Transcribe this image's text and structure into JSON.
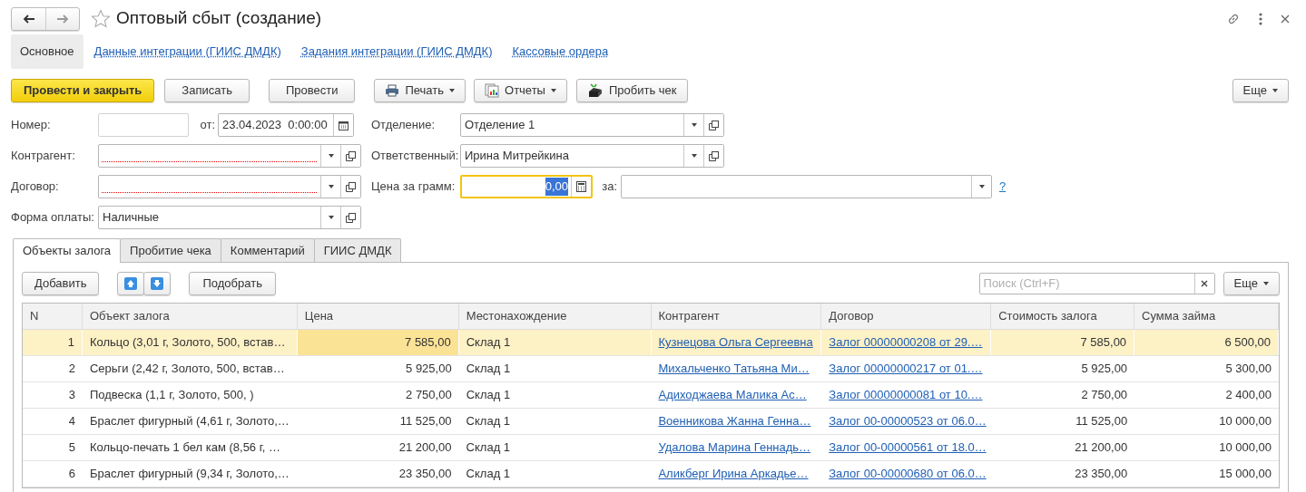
{
  "window": {
    "title": "Оптовый сбыт (создание)"
  },
  "sections": [
    {
      "label": "Основное",
      "selected": true
    },
    {
      "label": "Данные интеграции (ГИИС ДМДК)",
      "selected": false
    },
    {
      "label": "Задания интеграции (ГИИС ДМДК)",
      "selected": false
    },
    {
      "label": "Кассовые ордера",
      "selected": false
    }
  ],
  "toolbar": {
    "buttons": [
      {
        "label": "Провести и закрыть",
        "kind": "primary"
      },
      {
        "label": "Записать",
        "kind": "plain"
      },
      {
        "label": "Провести",
        "kind": "plain"
      },
      {
        "label": "Печать",
        "kind": "menu"
      },
      {
        "label": "Отчеты",
        "kind": "menu"
      },
      {
        "label": "Пробить чек",
        "kind": "plain"
      }
    ],
    "more": "Еще"
  },
  "form": {
    "number": {
      "label": "Номер:"
    },
    "date": {
      "label": "от:",
      "value": "23.04.2023  0:00:00"
    },
    "left": [
      {
        "label": "Контрагент:",
        "required": true
      },
      {
        "label": "Договор:",
        "required": true
      },
      {
        "label": "Форма оплаты:",
        "value": "Наличные",
        "required": false
      }
    ],
    "right": [
      {
        "label": "Отделение:",
        "value": "Отделение 1"
      },
      {
        "label": "Ответственный:",
        "value": "Ирина Митрейкина"
      }
    ],
    "price": {
      "label": "Цена за грамм:",
      "value": "0,00",
      "focused": true
    },
    "per": {
      "label": "за:",
      "help": "?"
    }
  },
  "tabs": [
    {
      "label": "Объекты залога",
      "selected": true
    },
    {
      "label": "Пробитие чека",
      "selected": false
    },
    {
      "label": "Комментарий",
      "selected": false
    },
    {
      "label": "ГИИС ДМДК",
      "selected": false
    }
  ],
  "table_toolbar": {
    "add": "Добавить",
    "pick": "Подобрать",
    "search": {
      "placeholder": "Поиск (Ctrl+F)"
    },
    "more": "Еще"
  },
  "table": {
    "columns": [
      {
        "label": "N",
        "kind": "number"
      },
      {
        "label": "Объект залога",
        "kind": "text"
      },
      {
        "label": "Цена",
        "kind": "number",
        "current": true
      },
      {
        "label": "Местонахождение",
        "kind": "text"
      },
      {
        "label": "Контрагент",
        "kind": "link"
      },
      {
        "label": "Договор",
        "kind": "link"
      },
      {
        "label": "Стоимость залога",
        "kind": "number"
      },
      {
        "label": "Сумма займа",
        "kind": "number"
      }
    ],
    "rows": [
      {
        "cells": [
          "1",
          "Кольцо (3,01 г, Золото, 500, встав…",
          "7 585,00",
          "Склад 1",
          "Кузнецова Ольга Сергеевна",
          "Залог 00000000208 от 29.…",
          "7 585,00",
          "6 500,00"
        ],
        "selected": true
      },
      {
        "cells": [
          "2",
          "Серьги (2,42 г, Золото, 500, встав…",
          "5 925,00",
          "Склад 1",
          "Михальченко Татьяна Ми…",
          "Залог 00000000217 от 01.…",
          "5 925,00",
          "5 300,00"
        ],
        "selected": false
      },
      {
        "cells": [
          "3",
          "Подвеска (1,1 г, Золото, 500, )",
          "2 750,00",
          "Склад 1",
          "Адиходжаева Малика Ас…",
          "Залог 00000000081 от 10.…",
          "2 750,00",
          "2 400,00"
        ],
        "selected": false
      },
      {
        "cells": [
          "4",
          "Браслет фигурный (4,61 г, Золото,…",
          "11 525,00",
          "Склад 1",
          "Военникова Жанна Генна…",
          "Залог 00-00000523 от 06.0…",
          "11 525,00",
          "10 000,00"
        ],
        "selected": false
      },
      {
        "cells": [
          "5",
          "Кольцо-печать 1 бел кам  (8,56 г, …",
          "21 200,00",
          "Склад 1",
          "Удалова Марина Геннадь…",
          "Залог 00-00000561 от 18.0…",
          "21 200,00",
          "10 000,00"
        ],
        "selected": false
      },
      {
        "cells": [
          "6",
          "Браслет фигурный (9,34 г, Золото,…",
          "23 350,00",
          "Склад 1",
          "Аликберг Ирина Аркадье…",
          "Залог 00-00000680 от 06.0…",
          "23 350,00",
          "15 000,00"
        ],
        "selected": false
      }
    ]
  }
}
